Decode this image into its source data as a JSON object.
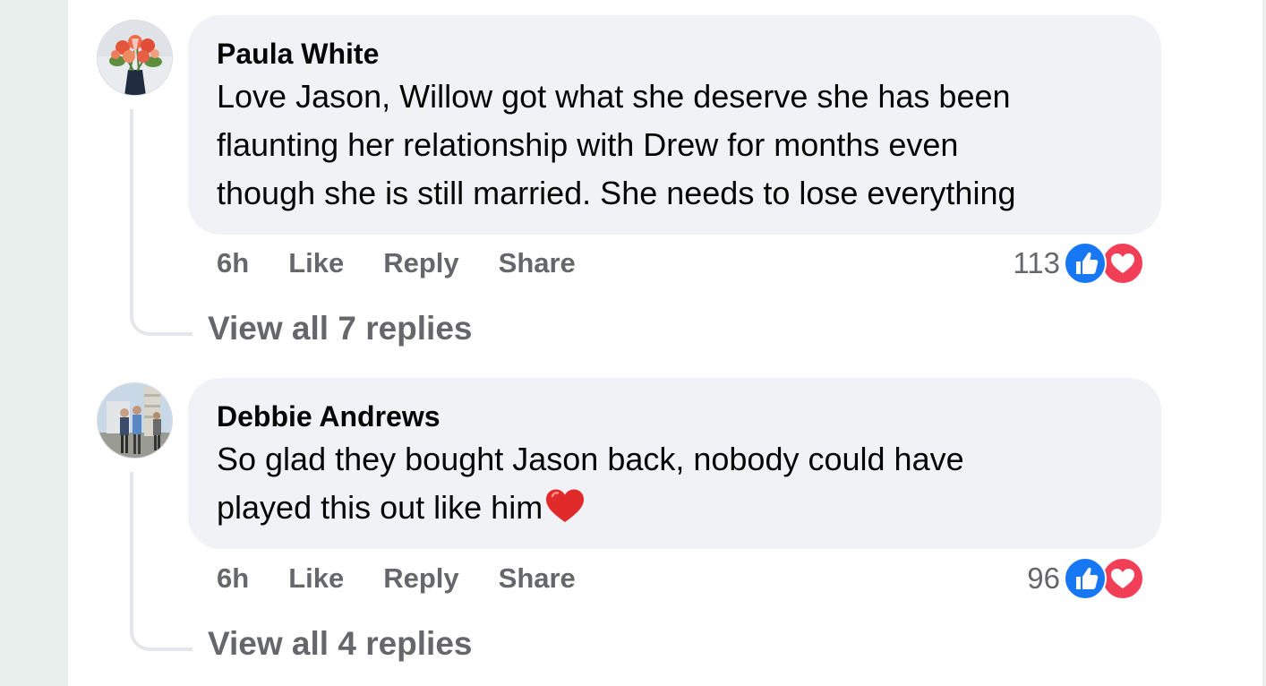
{
  "comments": [
    {
      "author": "Paula White",
      "text_lines": [
        "Love Jason, Willow got what she deserve she has been",
        "flaunting her relationship with Drew for months even",
        "though she is still married. She needs to lose everything"
      ],
      "time": "6h",
      "like_label": "Like",
      "reply_label": "Reply",
      "share_label": "Share",
      "reaction_count": "113",
      "reaction_icons": [
        "like-icon",
        "love-icon"
      ],
      "view_replies": "View all 7 replies"
    },
    {
      "author": "Debbie Andrews",
      "text_lines": [
        "So glad they bought Jason back, nobody could have",
        "played this out like him"
      ],
      "trailing_emoji": "heart-emoji",
      "time": "6h",
      "like_label": "Like",
      "reply_label": "Reply",
      "share_label": "Share",
      "reaction_count": "96",
      "reaction_icons": [
        "like-icon",
        "love-icon"
      ],
      "view_replies": "View all 4 replies"
    }
  ],
  "colors": {
    "bubble_bg": "#f0f2f5",
    "secondary_text": "#65676b",
    "like_blue": "#1877f2",
    "love_red": "#f33e58",
    "page_edge": "#e8efec"
  }
}
